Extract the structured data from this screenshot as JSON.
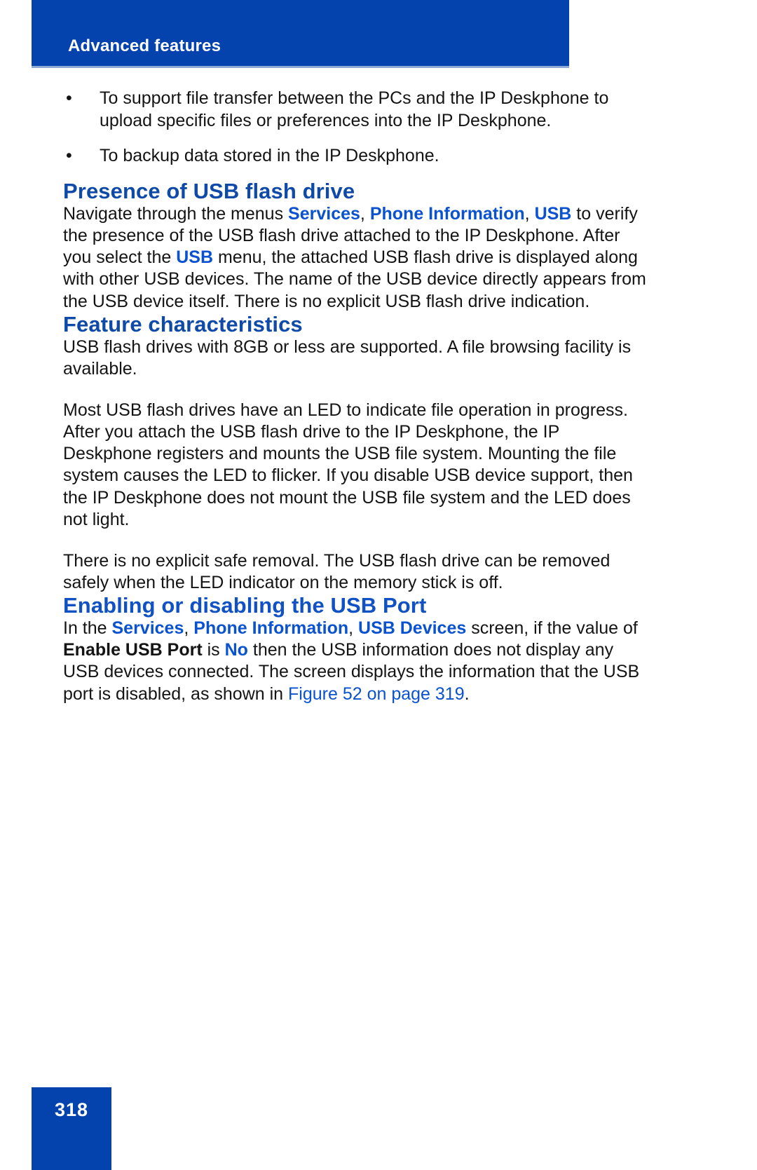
{
  "header": {
    "running_title": "Advanced features",
    "bar_color": "#0442AD"
  },
  "footer": {
    "page_number": "318",
    "box_color": "#0442AD"
  },
  "colors": {
    "heading_blue": "#0F4AA8",
    "heading_blue_bright": "#1051C4",
    "link_blue": "#0A52CF",
    "body_black": "#141414"
  },
  "content": {
    "bullets": [
      {
        "marker": "•",
        "text": "To support file transfer between the PCs and the IP Deskphone to upload specific files or preferences into the IP Deskphone."
      },
      {
        "marker": "•",
        "text": "To backup data stored in the IP Deskphone."
      }
    ],
    "sections": [
      {
        "heading": "Presence of USB flash drive",
        "paragraphs": [
          {
            "runs": [
              {
                "text": "Navigate through the menus ",
                "style": "plain"
              },
              {
                "text": "Services",
                "style": "link"
              },
              {
                "text": ", ",
                "style": "plain"
              },
              {
                "text": "Phone Information",
                "style": "link"
              },
              {
                "text": ", ",
                "style": "plain"
              },
              {
                "text": "USB",
                "style": "link"
              },
              {
                "text": " to verify the presence of the USB flash drive attached to the IP Deskphone. After you select the ",
                "style": "plain"
              },
              {
                "text": "USB",
                "style": "link"
              },
              {
                "text": " menu, the attached USB flash drive is displayed along with other USB devices. The name of the USB device directly appears from the USB device itself. There is no explicit USB flash drive indication.",
                "style": "plain"
              }
            ]
          }
        ]
      },
      {
        "heading": "Feature characteristics",
        "paragraphs": [
          {
            "runs": [
              {
                "text": "USB flash drives with 8GB or less are supported. A file browsing facility is available.",
                "style": "plain"
              }
            ]
          },
          {
            "runs": [
              {
                "text": "Most USB flash drives have an LED to indicate file operation in progress. After you attach the USB flash drive to the IP Deskphone, the IP Deskphone registers and mounts the USB file system. Mounting the file system causes the LED to flicker. If you disable USB device support, then the IP Deskphone does not mount the USB file system and the LED does not light.",
                "style": "plain"
              }
            ]
          },
          {
            "runs": [
              {
                "text": "There is no explicit safe removal. The USB flash drive can be removed safely when the LED indicator on the memory stick is off.",
                "style": "plain"
              }
            ]
          }
        ]
      },
      {
        "heading": "Enabling or disabling the USB Port",
        "paragraphs": [
          {
            "runs": [
              {
                "text": "In the ",
                "style": "plain"
              },
              {
                "text": "Services",
                "style": "link"
              },
              {
                "text": ", ",
                "style": "plain"
              },
              {
                "text": "Phone Information",
                "style": "link"
              },
              {
                "text": ", ",
                "style": "plain"
              },
              {
                "text": "USB Devices",
                "style": "link"
              },
              {
                "text": " screen, if the value of ",
                "style": "plain"
              },
              {
                "text": "Enable USB Port",
                "style": "strong"
              },
              {
                "text": " is ",
                "style": "plain"
              },
              {
                "text": "No",
                "style": "link"
              },
              {
                "text": " then the USB information does not display any USB devices connected. The screen displays the information that the USB port is disabled, as shown in ",
                "style": "plain"
              },
              {
                "text": "Figure 52 on page 319",
                "style": "xref"
              },
              {
                "text": ".",
                "style": "plain"
              }
            ]
          }
        ]
      }
    ]
  }
}
